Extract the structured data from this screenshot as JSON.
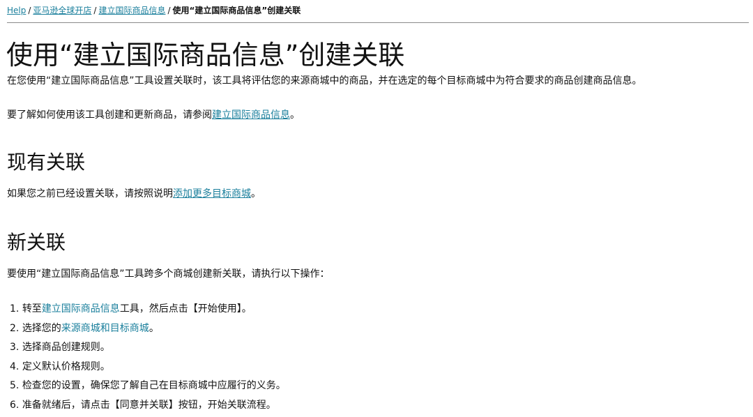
{
  "breadcrumb": {
    "items": [
      {
        "label": "Help"
      },
      {
        "label": "亚马逊全球开店"
      },
      {
        "label": "建立国际商品信息"
      }
    ],
    "separator": "/",
    "current": "使用“建立国际商品信息”创建关联"
  },
  "main": {
    "title": "使用“建立国际商品信息”创建关联",
    "intro": "在您使用“建立国际商品信息”工具设置关联时，该工具将评估您的来源商城中的商品，并在选定的每个目标商城中为符合要求的商品创建商品信息。",
    "learn_more": {
      "prefix": "要了解如何使用该工具创建和更新商品，请参阅",
      "link": "建立国际商品信息",
      "suffix": "。"
    }
  },
  "existing": {
    "heading": "现有关联",
    "text_prefix": "如果您之前已经设置关联，请按照说明",
    "link": "添加更多目标商城",
    "text_suffix": "。"
  },
  "new_links": {
    "heading": "新关联",
    "intro": "要使用“建立国际商品信息”工具跨多个商城创建新关联，请执行以下操作：",
    "steps": [
      {
        "num": "1.",
        "pre": "转至",
        "link": "建立国际商品信息",
        "post": "工具，然后点击【开始使用】。"
      },
      {
        "num": "2.",
        "pre": "选择您的",
        "link": "来源商城和目标商城",
        "post": "。"
      },
      {
        "num": "3.",
        "pre": "选择商品创建规则。",
        "link": "",
        "post": ""
      },
      {
        "num": "4.",
        "pre": "定义默认价格规则。",
        "link": "",
        "post": ""
      },
      {
        "num": "5.",
        "pre": "检查您的设置，确保您了解自己在目标商城中应履行的义务。",
        "link": "",
        "post": ""
      },
      {
        "num": "6.",
        "pre": "准备就绪后，请点击【同意并关联】按钮，开始关联流程。",
        "link": "",
        "post": ""
      }
    ]
  },
  "colors": {
    "link": "#1a7f9c",
    "text": "#111111",
    "rule": "#8a8a8a"
  }
}
